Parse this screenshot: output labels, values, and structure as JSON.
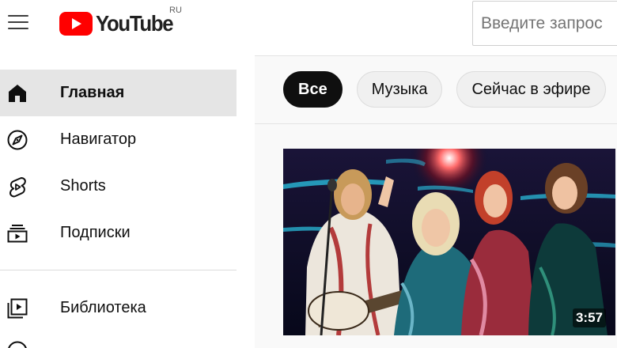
{
  "header": {
    "logo_text": "YouTube",
    "country_code": "RU",
    "search_placeholder": "Введите запрос"
  },
  "sidebar": {
    "items": [
      {
        "label": "Главная",
        "icon": "home-icon",
        "active": true
      },
      {
        "label": "Навигатор",
        "icon": "compass-icon",
        "active": false
      },
      {
        "label": "Shorts",
        "icon": "shorts-icon",
        "active": false
      },
      {
        "label": "Подписки",
        "icon": "subscriptions-icon",
        "active": false
      },
      {
        "label": "Библиотека",
        "icon": "library-icon",
        "active": false
      }
    ]
  },
  "chips": [
    {
      "label": "Все",
      "active": true
    },
    {
      "label": "Музыка",
      "active": false
    },
    {
      "label": "Сейчас в эфире",
      "active": false
    }
  ],
  "video": {
    "duration": "3:57"
  },
  "colors": {
    "brand_red": "#ff0000",
    "active_bg": "#e5e5e5",
    "chip_active": "#0f0f0f"
  }
}
